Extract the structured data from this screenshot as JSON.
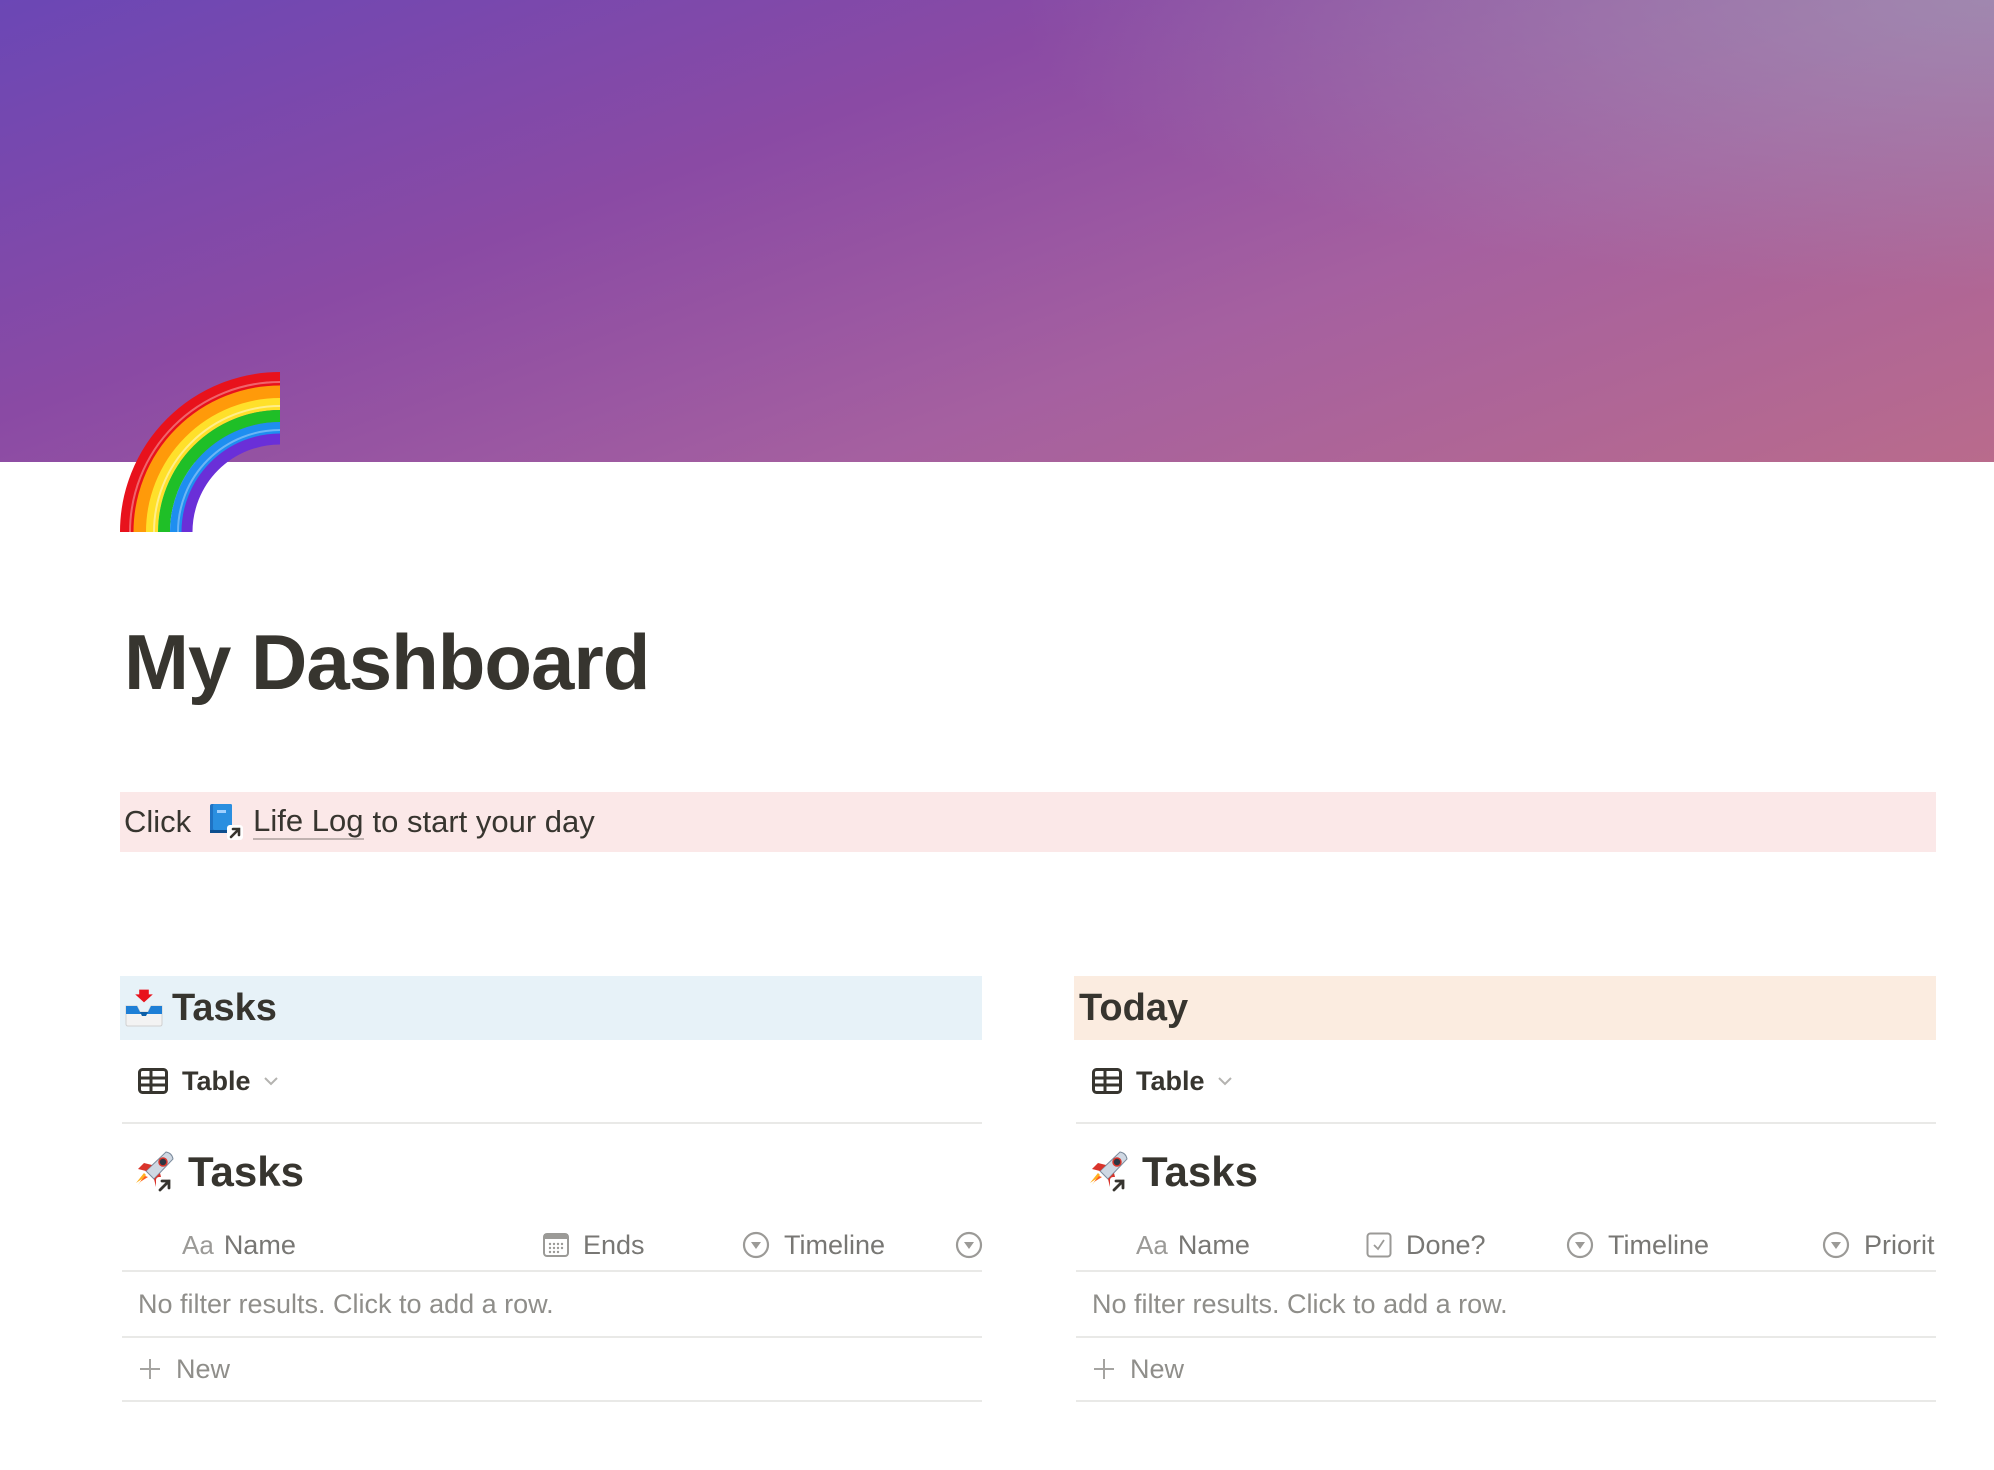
{
  "page": {
    "title": "My Dashboard",
    "icon": "rainbow-icon",
    "cover_colors": [
      "#6b47b5",
      "#9c8ab4",
      "#b96b8c",
      "#8c3c9c"
    ]
  },
  "callout": {
    "prefix": "Click",
    "link_icon": "book-link-icon",
    "link_text": "Life Log",
    "suffix": "to start your day",
    "background": "#fbe8e8"
  },
  "columns": [
    {
      "header": {
        "icon": "inbox-tray-icon",
        "text": "Tasks",
        "background": "#e7f2f8"
      },
      "view": {
        "icon": "table-icon",
        "label": "Table"
      },
      "database": {
        "icon": "rocket-link-icon",
        "title": "Tasks",
        "columns": [
          {
            "icon": "text-property-icon",
            "label": "Name"
          },
          {
            "icon": "calendar-icon",
            "label": "Ends"
          },
          {
            "icon": "select-icon",
            "label": "Timeline"
          },
          {
            "icon": "select-icon",
            "label": ""
          }
        ],
        "empty_text": "No filter results. Click to add a row.",
        "new_label": "New"
      }
    },
    {
      "header": {
        "icon": "",
        "text": "Today",
        "background": "#fbece0"
      },
      "view": {
        "icon": "table-icon",
        "label": "Table"
      },
      "database": {
        "icon": "rocket-link-icon",
        "title": "Tasks",
        "columns": [
          {
            "icon": "text-property-icon",
            "label": "Name"
          },
          {
            "icon": "checkbox-icon",
            "label": "Done?"
          },
          {
            "icon": "select-icon",
            "label": "Timeline"
          },
          {
            "icon": "select-icon",
            "label": "Priorit"
          }
        ],
        "empty_text": "No filter results. Click to add a row.",
        "new_label": "New"
      }
    }
  ]
}
